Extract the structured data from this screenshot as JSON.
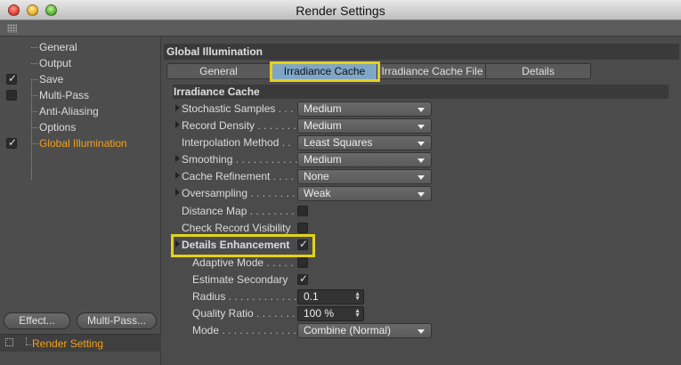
{
  "window": {
    "title": "Render Settings"
  },
  "sidebar": {
    "items": [
      {
        "label": "General",
        "checkbox": false,
        "checked": false,
        "active": false
      },
      {
        "label": "Output",
        "checkbox": false,
        "checked": false,
        "active": false
      },
      {
        "label": "Save",
        "checkbox": true,
        "checked": true,
        "active": false
      },
      {
        "label": "Multi-Pass",
        "checkbox": true,
        "checked": false,
        "active": false
      },
      {
        "label": "Anti-Aliasing",
        "checkbox": false,
        "checked": false,
        "active": false
      },
      {
        "label": "Options",
        "checkbox": false,
        "checked": false,
        "active": false
      },
      {
        "label": "Global Illumination",
        "checkbox": true,
        "checked": true,
        "active": true
      }
    ],
    "effect_button": "Effect...",
    "multipass_button": "Multi-Pass...",
    "render_setting_label": "Render Setting"
  },
  "main": {
    "section_title": "Global Illumination",
    "tabs": [
      {
        "label": "General",
        "selected": false
      },
      {
        "label": "Irradiance Cache",
        "selected": true
      },
      {
        "label": "Irradiance Cache File",
        "selected": false
      },
      {
        "label": "Details",
        "selected": false
      }
    ],
    "subsection_title": "Irradiance Cache",
    "params": {
      "stochastic_samples": {
        "label": "Stochastic Samples",
        "dots": " . . . .",
        "value": "Medium"
      },
      "record_density": {
        "label": "Record Density",
        "dots": " . . . . . . .",
        "value": "Medium"
      },
      "interpolation_method": {
        "label": "Interpolation Method",
        "dots": " . .",
        "value": "Least Squares"
      },
      "smoothing": {
        "label": "Smoothing",
        "dots": " . . . . . . . . . . .",
        "value": "Medium"
      },
      "cache_refinement": {
        "label": "Cache Refinement",
        "dots": " . . . .",
        "value": "None"
      },
      "oversampling": {
        "label": "Oversampling",
        "dots": " . . . . . . . .",
        "value": "Weak"
      },
      "distance_map": {
        "label": "Distance Map",
        "dots": " . . . . . . . .",
        "checked": false
      },
      "check_record_visibility": {
        "label": "Check Record Visibility",
        "checked": false
      },
      "details_enhancement": {
        "label": "Details Enhancement",
        "checked": true
      },
      "adaptive_mode": {
        "label": "Adaptive Mode",
        "dots": " . . . . .",
        "checked": false
      },
      "estimate_secondary": {
        "label": "Estimate Secondary",
        "checked": true
      },
      "radius": {
        "label": "Radius",
        "dots": " . . . . . . . . . . . . . .",
        "value": "0.1"
      },
      "quality_ratio": {
        "label": "Quality Ratio",
        "dots": " . . . . . . .",
        "value": "100 %"
      },
      "mode": {
        "label": "Mode",
        "dots": " . . . . . . . . . . . . . . . .",
        "value": "Combine (Normal)"
      }
    }
  },
  "colors": {
    "accent_orange": "#f2a01b",
    "highlight_yellow": "#e4d21a",
    "tab_selected": "#7fa6c7"
  }
}
